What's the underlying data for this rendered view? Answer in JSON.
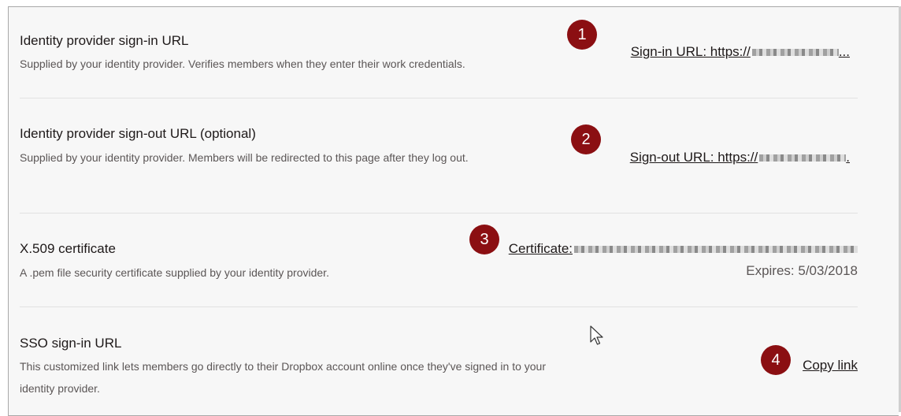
{
  "sections": [
    {
      "title": "Identity provider sign-in URL",
      "description": "Supplied by your identity provider. Verifies members when they enter their work credentials.",
      "value_label": "Sign-in URL: https://",
      "value_suffix": "...",
      "badge": "1"
    },
    {
      "title": "Identity provider sign-out URL (optional)",
      "description": "Supplied by your identity provider. Members will be redirected to this page after they log out.",
      "value_label": "Sign-out URL: https://",
      "value_suffix": ".",
      "badge": "2"
    },
    {
      "title": "X.509 certificate",
      "description": "A .pem file security certificate supplied by your identity provider.",
      "value_label": "Certificate:",
      "expires": "Expires: 5/03/2018",
      "badge": "3"
    },
    {
      "title": "SSO sign-in URL",
      "description": "This customized link lets members go directly to their Dropbox account online once they've signed in to your identity provider.",
      "action_label": "Copy link",
      "badge": "4"
    }
  ],
  "colors": {
    "badge": "#8b0f12",
    "panel_bg": "#f7f7f7",
    "text": "#1e1919",
    "muted": "#5b5656"
  },
  "icons": {
    "pointer": "mouse-pointer-icon"
  }
}
